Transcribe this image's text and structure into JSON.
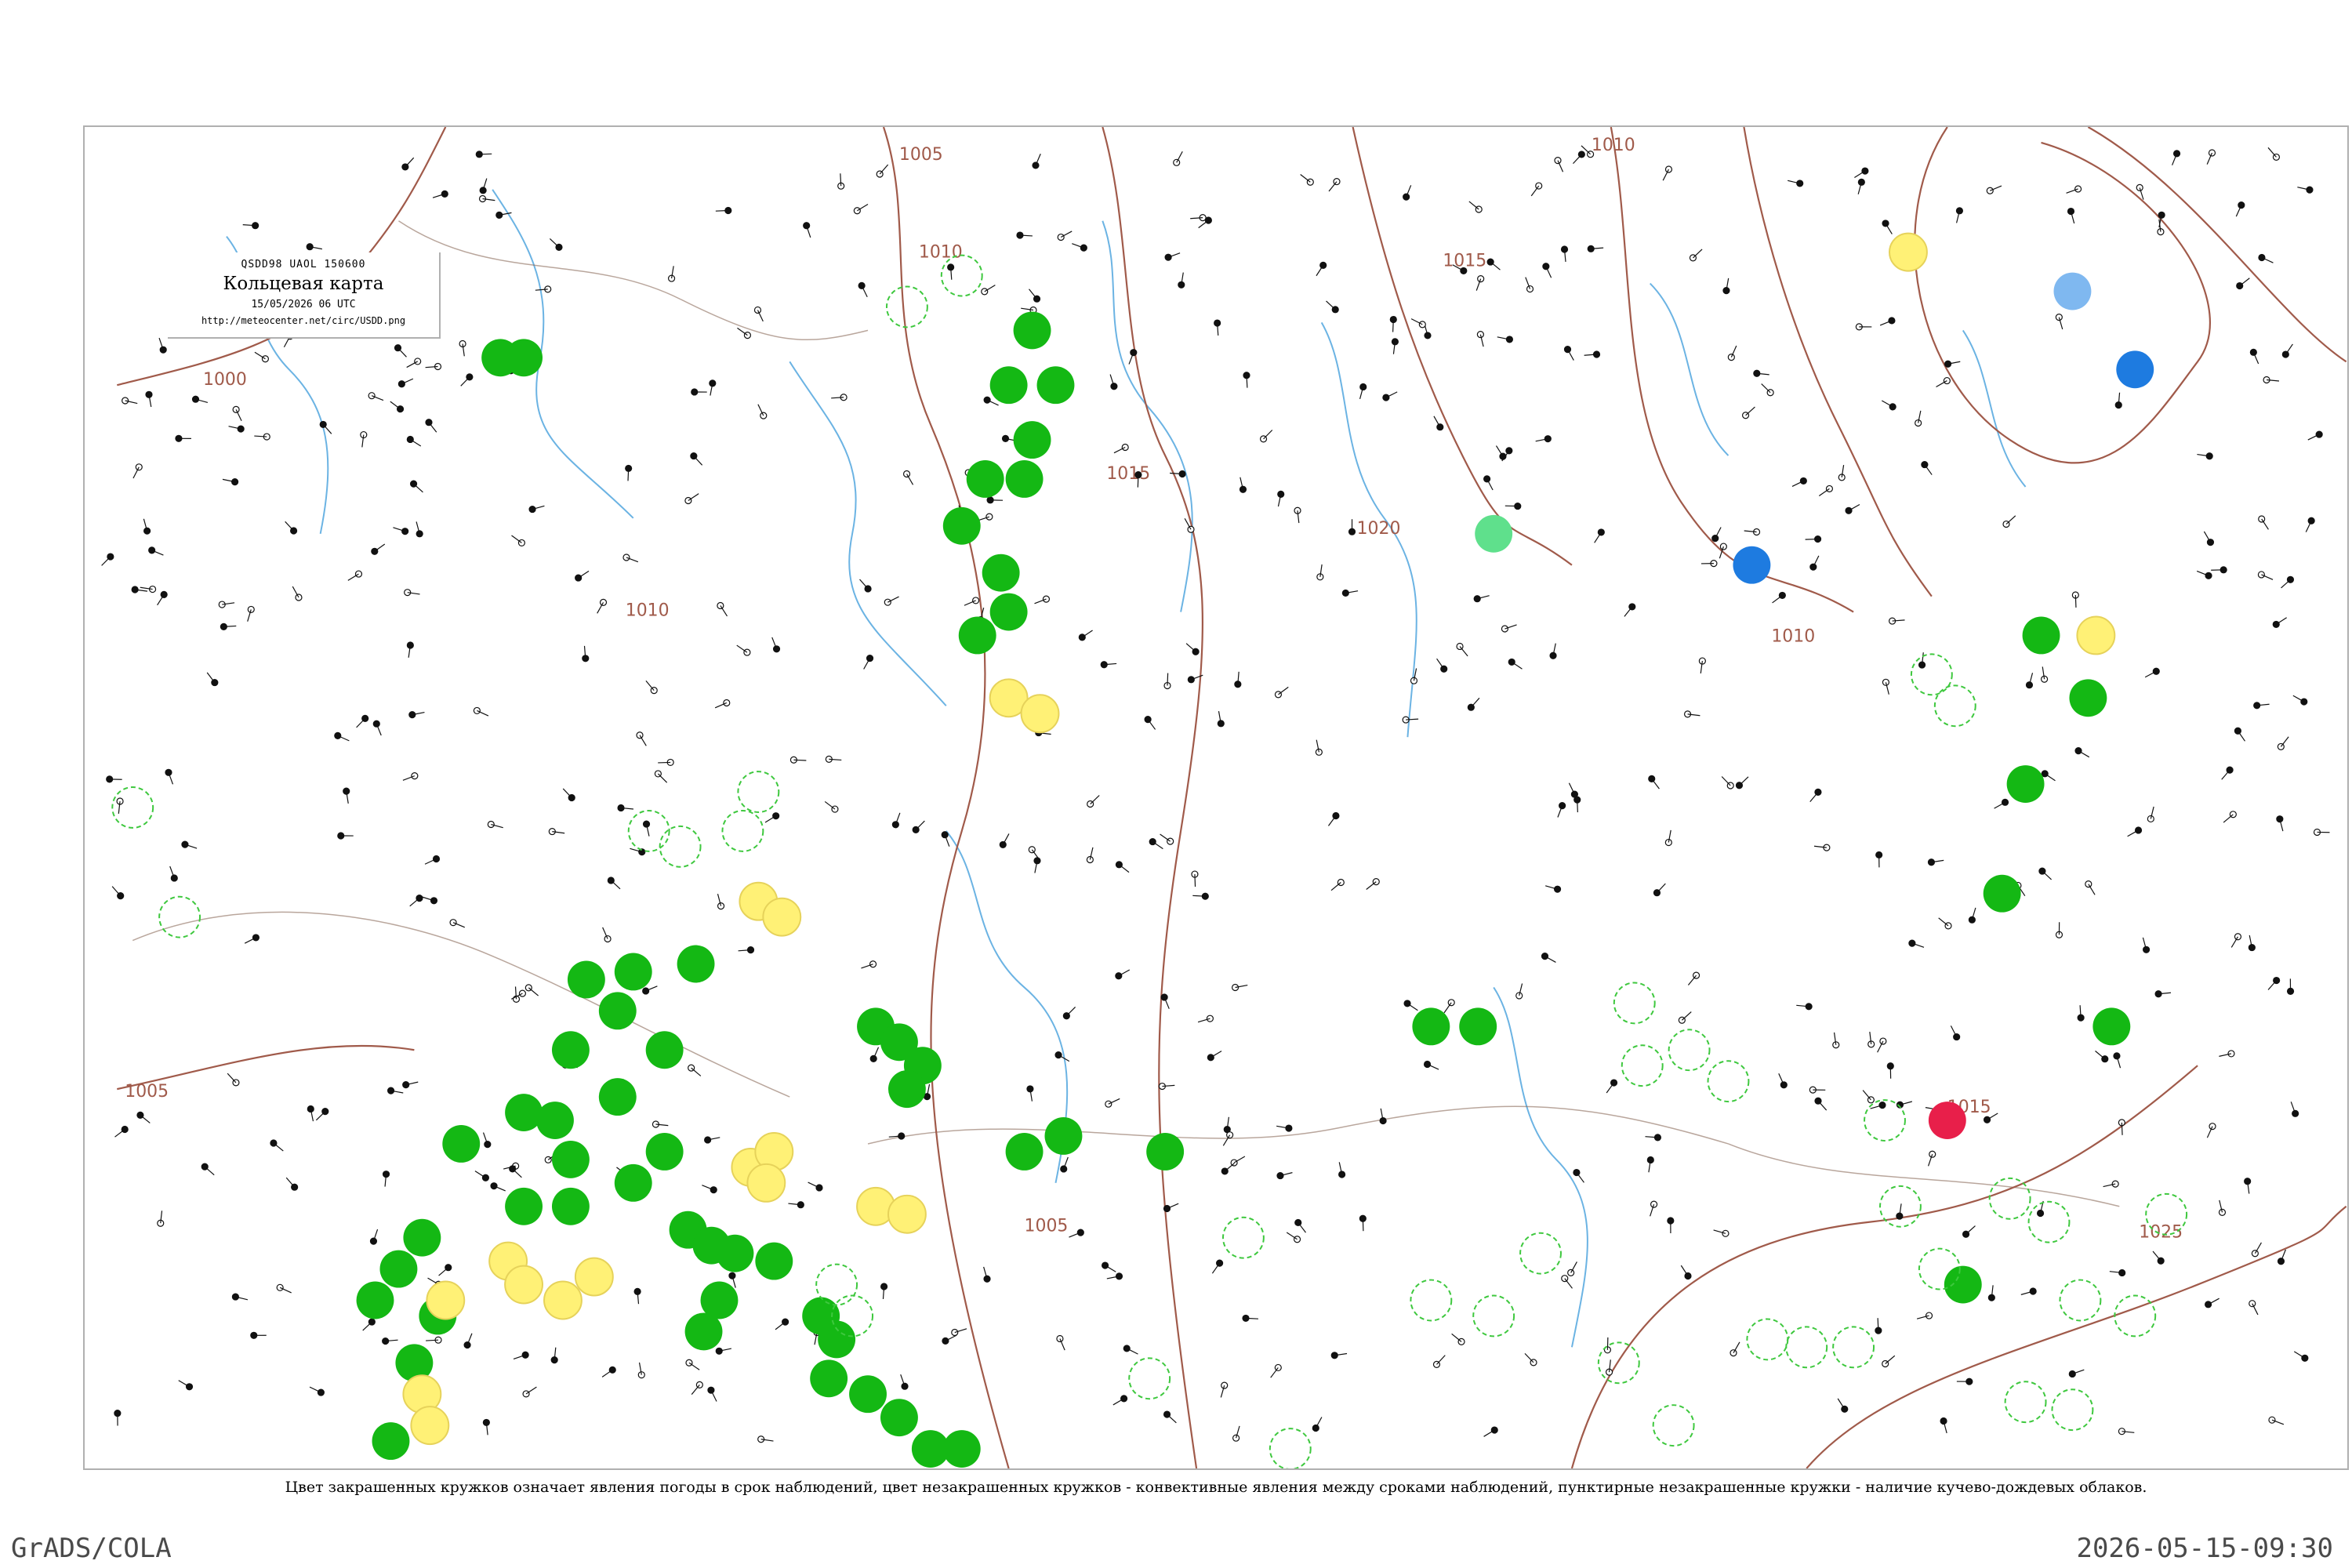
{
  "header": {
    "code": "QSDD98  UAOL  150600",
    "title": "Кольцевая карта",
    "date": "15/05/2026 06 UTC",
    "url": "http://meteocenter.net/circ/USDD.png"
  },
  "isobars": [
    {
      "value": "1000"
    },
    {
      "value": "1005"
    },
    {
      "value": "1005"
    },
    {
      "value": "1005"
    },
    {
      "value": "1010"
    },
    {
      "value": "1010"
    },
    {
      "value": "1010"
    },
    {
      "value": "1010"
    },
    {
      "value": "1015"
    },
    {
      "value": "1015"
    },
    {
      "value": "1015"
    },
    {
      "value": "1020"
    },
    {
      "value": "1025"
    }
  ],
  "caption": "Цвет закрашенных кружков означает явления погоды в срок наблюдений, цвет незакрашенных кружков - конвективные явления между сроками наблюдений, пунктирные незакрашенные кружки - наличие кучево-дождевых облаков.",
  "footer": {
    "left": "GrADS/COLA",
    "right": "2026-05-15-09:30"
  },
  "colors": {
    "isobar": "#a05a4a",
    "water": "#3a9ad9",
    "rain": "#14b814",
    "drizzle_yellow": "#fff176",
    "fog_orange": "#f4a020",
    "snow_blue": "#1e7be0",
    "light_blue": "#7fb8f0",
    "thunder_red": "#e81f4a",
    "mint": "#5fe08c",
    "frame": "#b0b0b0"
  },
  "legend_icons": [
    "station-circle-icon",
    "wind-barb-icon",
    "rain-dot-icon"
  ]
}
